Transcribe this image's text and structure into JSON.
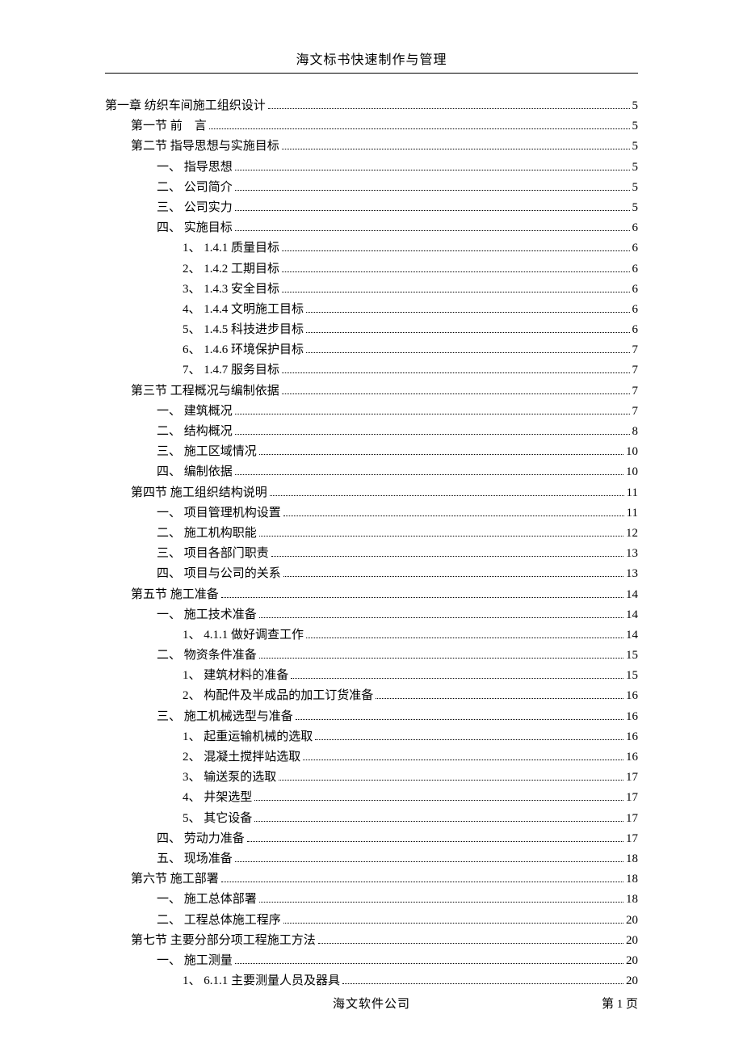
{
  "header": "海文标书快速制作与管理",
  "footer_center": "海文软件公司",
  "footer_right": "第 1 页",
  "toc": [
    {
      "level": 1,
      "label": "第一章  纺织车间施工组织设计",
      "page": "5"
    },
    {
      "level": 2,
      "label": "第一节  前　言",
      "page": "5"
    },
    {
      "level": 2,
      "label": "第二节  指导思想与实施目标",
      "page": "5"
    },
    {
      "level": 3,
      "label": "一、  指导思想",
      "page": "5"
    },
    {
      "level": 3,
      "label": "二、  公司简介",
      "page": "5"
    },
    {
      "level": 3,
      "label": "三、  公司实力",
      "page": "5"
    },
    {
      "level": 3,
      "label": "四、  实施目标",
      "page": "6"
    },
    {
      "level": 4,
      "label": "1、  1.4.1 质量目标",
      "page": "6"
    },
    {
      "level": 4,
      "label": "2、  1.4.2 工期目标",
      "page": "6"
    },
    {
      "level": 4,
      "label": "3、  1.4.3 安全目标",
      "page": "6"
    },
    {
      "level": 4,
      "label": "4、  1.4.4 文明施工目标",
      "page": "6"
    },
    {
      "level": 4,
      "label": "5、  1.4.5 科技进步目标",
      "page": "6"
    },
    {
      "level": 4,
      "label": "6、  1.4.6 环境保护目标",
      "page": "7"
    },
    {
      "level": 4,
      "label": "7、  1.4.7 服务目标",
      "page": "7"
    },
    {
      "level": 2,
      "label": "第三节  工程概况与编制依据",
      "page": "7"
    },
    {
      "level": 3,
      "label": "一、  建筑概况",
      "page": "7"
    },
    {
      "level": 3,
      "label": "二、  结构概况",
      "page": "8"
    },
    {
      "level": 3,
      "label": "三、  施工区域情况",
      "page": "10"
    },
    {
      "level": 3,
      "label": "四、  编制依据",
      "page": "10"
    },
    {
      "level": 2,
      "label": "第四节  施工组织结构说明",
      "page": "11"
    },
    {
      "level": 3,
      "label": "一、  项目管理机构设置",
      "page": "11"
    },
    {
      "level": 3,
      "label": "二、  施工机构职能",
      "page": "12"
    },
    {
      "level": 3,
      "label": "三、  项目各部门职责",
      "page": "13"
    },
    {
      "level": 3,
      "label": "四、  项目与公司的关系",
      "page": "13"
    },
    {
      "level": 2,
      "label": "第五节  施工准备",
      "page": "14"
    },
    {
      "level": 3,
      "label": "一、  施工技术准备",
      "page": "14"
    },
    {
      "level": 4,
      "label": "1、  4.1.1 做好调查工作",
      "page": "14"
    },
    {
      "level": 3,
      "label": "二、  物资条件准备",
      "page": "15"
    },
    {
      "level": 4,
      "label": "1、  建筑材料的准备",
      "page": "15"
    },
    {
      "level": 4,
      "label": "2、  构配件及半成品的加工订货准备",
      "page": "16"
    },
    {
      "level": 3,
      "label": "三、  施工机械选型与准备",
      "page": "16"
    },
    {
      "level": 4,
      "label": "1、  起重运输机械的选取",
      "page": "16"
    },
    {
      "level": 4,
      "label": "2、  混凝土搅拌站选取",
      "page": "16"
    },
    {
      "level": 4,
      "label": "3、  输送泵的选取",
      "page": "17"
    },
    {
      "level": 4,
      "label": "4、  井架选型",
      "page": "17"
    },
    {
      "level": 4,
      "label": "5、  其它设备",
      "page": "17"
    },
    {
      "level": 3,
      "label": "四、  劳动力准备",
      "page": "17"
    },
    {
      "level": 3,
      "label": "五、  现场准备",
      "page": "18"
    },
    {
      "level": 2,
      "label": "第六节  施工部署",
      "page": "18"
    },
    {
      "level": 3,
      "label": "一、  施工总体部署",
      "page": "18"
    },
    {
      "level": 3,
      "label": "二、  工程总体施工程序",
      "page": "20"
    },
    {
      "level": 2,
      "label": "第七节  主要分部分项工程施工方法",
      "page": "20"
    },
    {
      "level": 3,
      "label": "一、  施工测量",
      "page": "20"
    },
    {
      "level": 4,
      "label": "1、  6.1.1 主要测量人员及器具",
      "page": "20"
    }
  ]
}
